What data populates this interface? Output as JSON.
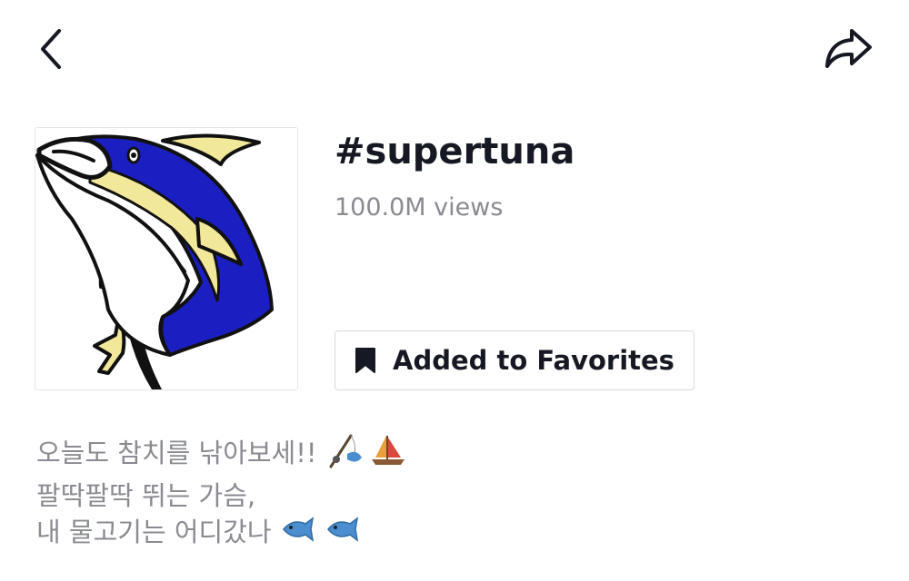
{
  "header": {
    "back_icon": "chevron-left-icon",
    "share_icon": "share-arrow-icon"
  },
  "hashtag": {
    "title": "#supertuna",
    "views": "100.0M views",
    "cover_image": "tuna-illustration"
  },
  "favorite_button": {
    "label": "Added to Favorites",
    "icon": "bookmark-icon"
  },
  "description": {
    "line1": "오늘도 참치를 낚아보세!!",
    "line1_emoji": [
      "fishing-pole-emoji",
      "sailboat-emoji"
    ],
    "line2": "팔딱팔딱 뛰는 가슴,",
    "line3": "내 물고기는 어디갔나",
    "line3_emoji": [
      "fish-emoji",
      "fish-emoji"
    ]
  },
  "colors": {
    "text_primary": "#161823",
    "text_secondary": "#8a8b91",
    "tuna_blue": "#1b1fc2",
    "tuna_yellow": "#f2e89a"
  }
}
